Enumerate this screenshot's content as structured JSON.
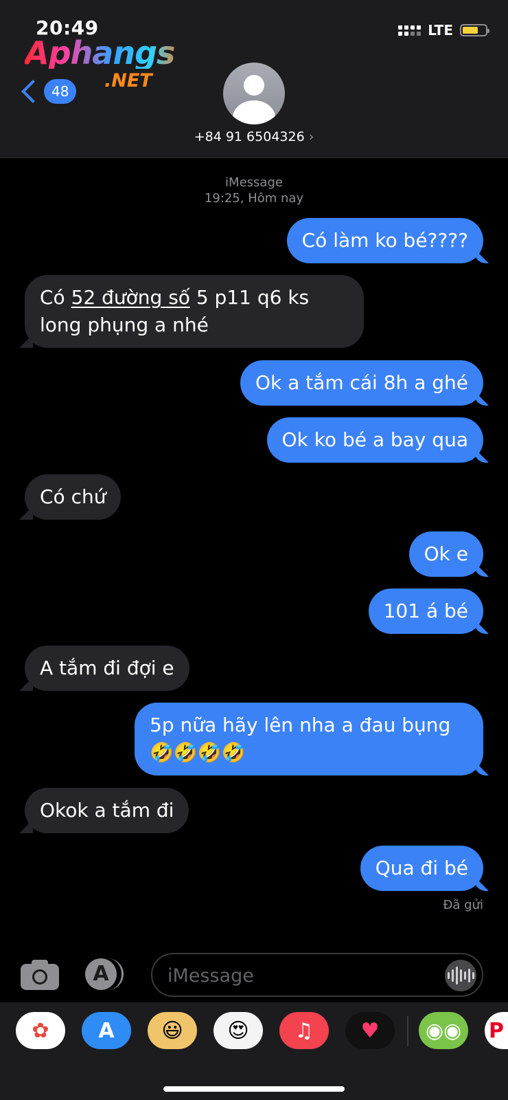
{
  "status_bar": {
    "time": "20:49",
    "network": "LTE"
  },
  "watermark": {
    "line1": "Aphangs",
    "line2": ".NET"
  },
  "header": {
    "back_count": "48",
    "contact": "+84 91 6504326",
    "contact_arrow": "›"
  },
  "thread": {
    "service": "iMessage",
    "timestamp": "19:25, Hôm nay",
    "messages": [
      {
        "dir": "out",
        "text": "Có làm ko bé????"
      },
      {
        "dir": "in",
        "text_pre": "Có ",
        "link": "52 đường số",
        "text_post": " 5 p11 q6 ks long phụng a nhé"
      },
      {
        "dir": "out",
        "text": "Ok a tắm cái 8h a ghé"
      },
      {
        "dir": "out",
        "text": "Ok ko bé a bay qua"
      },
      {
        "dir": "in",
        "text": "Có chứ"
      },
      {
        "dir": "out",
        "text": "Ok e"
      },
      {
        "dir": "out",
        "text": "101 á bé"
      },
      {
        "dir": "in",
        "text": "A tắm đi đợi e"
      },
      {
        "dir": "out",
        "text": "5p nữa hãy lên nha a đau bụng 🤣🤣🤣🤣"
      },
      {
        "dir": "in",
        "text": "Okok a tắm đi"
      },
      {
        "dir": "out",
        "text": "Qua đi bé"
      }
    ],
    "delivery_status": "Đã gửi"
  },
  "compose": {
    "placeholder": "iMessage",
    "appstore_glyph": "A"
  },
  "drawer": {
    "apps": [
      {
        "name": "photos",
        "glyph": "✿",
        "bg": "#ffffff",
        "color": "#e8493f"
      },
      {
        "name": "app-store",
        "glyph": "A",
        "bg": "#2f8cf5",
        "color": "#ffffff"
      },
      {
        "name": "memoji",
        "glyph": "😃",
        "bg": "#f0c46a",
        "color": "#000000"
      },
      {
        "name": "animoji-stickers",
        "glyph": "😍",
        "bg": "#f4f4f4",
        "color": "#000000"
      },
      {
        "name": "music",
        "glyph": "♫",
        "bg": "#f2434e",
        "color": "#ffffff"
      },
      {
        "name": "digital-touch",
        "glyph": "♥",
        "bg": "#111111",
        "color": "#ff3b6a"
      },
      {
        "name": "duolingo",
        "glyph": "◉◉",
        "bg": "#7bc44a",
        "color": "#ffffff"
      },
      {
        "name": "pinterest",
        "glyph": "P",
        "bg": "#ffffff",
        "color": "#e60023"
      }
    ]
  }
}
